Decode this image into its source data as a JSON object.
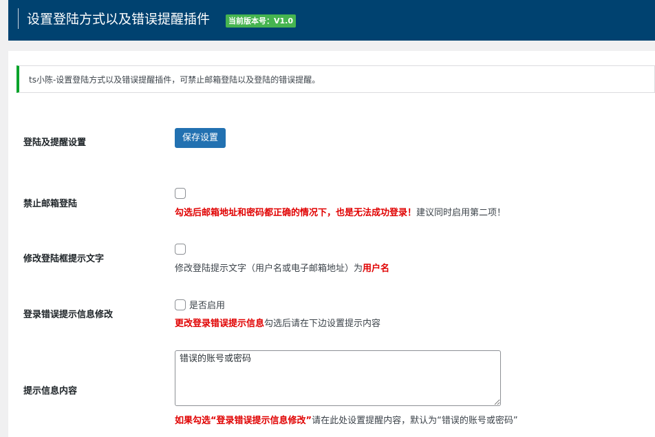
{
  "header": {
    "title": "设置登陆方式以及错误提醒插件",
    "version_badge": "当前版本号：V1.0"
  },
  "notice": {
    "text": "ts小陈-设置登陆方式以及错误提醒插件，可禁止邮箱登陆以及登陆的错误提醒。"
  },
  "settings": {
    "section_label": "登陆及提醒设置",
    "save_button": "保存设置",
    "disable_email": {
      "label": "禁止邮箱登陆",
      "checked": false,
      "desc_red": "勾选后邮箱地址和密码都正确的情况下，也是无法成功登录！",
      "desc_rest": "建议同时启用第二项！"
    },
    "login_hint_text": {
      "label": "修改登陆框提示文字",
      "checked": false,
      "desc_prefix": "修改登陆提示文字（用户名或电子邮箱地址）为",
      "desc_red": "用户名"
    },
    "error_message": {
      "label": "登录错误提示信息修改",
      "checked": false,
      "checkbox_label": "是否启用",
      "desc_red": "更改登录错误提示信息",
      "desc_rest": "勾选后请在下边设置提示内容"
    },
    "message_content": {
      "label": "提示信息内容",
      "value": "错误的账号或密码",
      "desc_red": "如果勾选“登录错误提示信息修改”",
      "desc_rest": "请在此处设置提醒内容，默认为“错误的账号或密码”"
    }
  },
  "colors": {
    "header_bg": "#004270",
    "badge_bg": "#46b450",
    "button_bg": "#2271b1",
    "notice_border": "#00a32a",
    "warning_red": "#e00000"
  }
}
